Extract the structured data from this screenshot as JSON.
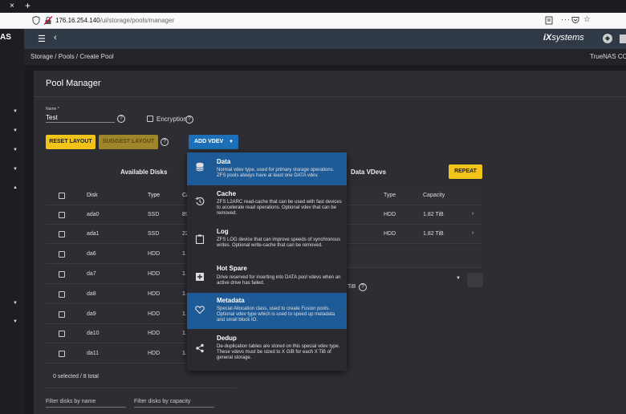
{
  "browser": {
    "close_glyph": "×",
    "new_tab_glyph": "+",
    "url_host": "176.16.254.140",
    "url_path": "/ui/storage/pools/manager",
    "more_glyph": "···"
  },
  "app": {
    "brand": "AS",
    "logo_prefix": "iX",
    "logo_suffix": "systems",
    "breadcrumb": "Storage  /   Pools  /   Create Pool",
    "hostname": "TrueNAS CORE"
  },
  "pool_manager": {
    "title": "Pool Manager",
    "name_label": "Name *",
    "name_value": "Test",
    "encryption_label": "Encryption",
    "reset_layout": "RESET LAYOUT",
    "suggest_layout": "SUGGEST LAYOUT",
    "add_vdev": "ADD VDEV",
    "repeat": "REPEAT",
    "available_disks_title": "Available Disks",
    "data_vdevs_title": "Data VDevs"
  },
  "disks_table": {
    "headers": {
      "disk": "Disk",
      "type": "Type",
      "capacity": "Ca"
    },
    "rows": [
      {
        "disk": "ada0",
        "type": "SSD",
        "capacity": "89"
      },
      {
        "disk": "ada1",
        "type": "SSD",
        "capacity": "22"
      },
      {
        "disk": "da6",
        "type": "HDD",
        "capacity": "1."
      },
      {
        "disk": "da7",
        "type": "HDD",
        "capacity": "1."
      },
      {
        "disk": "da8",
        "type": "HDD",
        "capacity": "1."
      },
      {
        "disk": "da9",
        "type": "HDD",
        "capacity": "1."
      },
      {
        "disk": "da10",
        "type": "HDD",
        "capacity": "1."
      },
      {
        "disk": "da11",
        "type": "HDD",
        "capacity": "1."
      }
    ],
    "footer": "0 selected / 8 total"
  },
  "vdev_table": {
    "headers": {
      "type": "Type",
      "capacity": "Capacity"
    },
    "rows": [
      {
        "type": "HDD",
        "capacity": "1.82 TiB"
      },
      {
        "type": "HDD",
        "capacity": "1.82 TiB"
      }
    ],
    "size_suffix": "TiB"
  },
  "filters": {
    "by_name": "Filter disks by name",
    "by_capacity": "Filter disks by capacity"
  },
  "vdev_menu": [
    {
      "title": "Data",
      "desc": "Normal vdev type, used for primary storage operations. ZFS pools always have at least one DATA vdev.",
      "icon": "database-icon"
    },
    {
      "title": "Cache",
      "desc": "ZFS L2ARC read-cache that can be used with fast devices to accelerate read operations. Optional vdev that can be removed.",
      "icon": "history-icon"
    },
    {
      "title": "Log",
      "desc": "ZFS LOG device that can improve speeds of synchronous writes. Optional write-cache that can be removed.",
      "icon": "clipboard-icon"
    },
    {
      "title": "Hot Spare",
      "desc": "Drive reserved for inserting into DATA pool vdevs when an active drive has failed.",
      "icon": "add-box-icon"
    },
    {
      "title": "Metadata",
      "desc": "Special Allocation class, used to create Fusion pools. Optional vdev type which is used to speed up metadata and small block IO.",
      "icon": "heart-icon"
    },
    {
      "title": "Dedup",
      "desc": "De-duplication tables are stored on this special vdev type. These vdevs must be sized to X GiB for each X TiB of general storage.",
      "icon": "share-icon"
    }
  ],
  "colors": {
    "accent_yellow": "#f0c419",
    "accent_blue": "#1d70b8",
    "menu_selected": "#1d5a96",
    "topbar": "#2f3a46"
  }
}
